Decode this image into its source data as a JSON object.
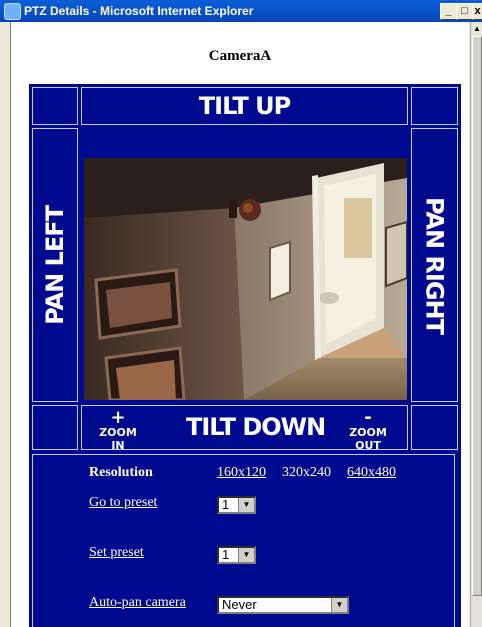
{
  "window": {
    "title": "PTZ Details - Microsoft Internet Explorer",
    "minimize": "_",
    "maximize": "□",
    "close": "x"
  },
  "camera": {
    "name": "CameraA"
  },
  "ptz": {
    "tilt_up": "TILT UP",
    "tilt_down": "TILT DOWN",
    "pan_left": "PAN LEFT",
    "pan_right": "PAN RIGHT",
    "zoom_in_symbol": "+",
    "zoom_in": "ZOOM IN",
    "zoom_out_symbol": "-",
    "zoom_out": "ZOOM OUT"
  },
  "controls": {
    "resolution_label": "Resolution",
    "resolutions": [
      "160x120",
      "320x240",
      "640x480"
    ],
    "goto_preset_label": "Go to preset",
    "goto_preset_value": "1",
    "set_preset_label": "Set preset",
    "set_preset_value": "1",
    "autopan_label": "Auto-pan camera",
    "autopan_value": "Never"
  },
  "colors": {
    "panel": "#000a8f",
    "titlebar": "#0a5fd8"
  }
}
